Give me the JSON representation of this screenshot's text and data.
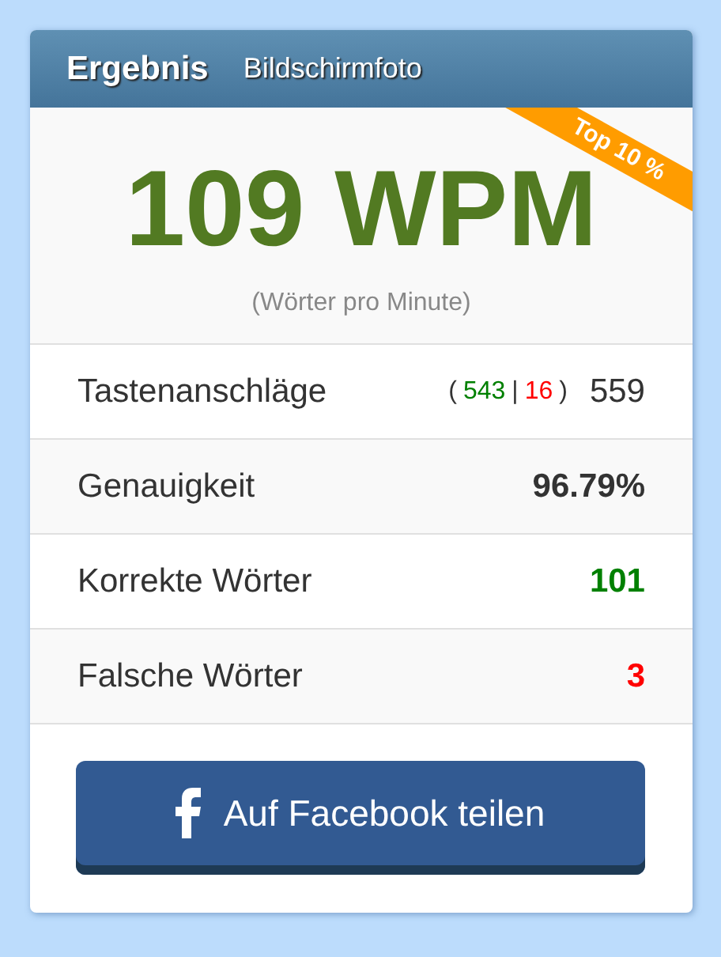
{
  "tabs": [
    {
      "label": "Ergebnis",
      "selected": true
    },
    {
      "label": "Bildschirmfoto",
      "selected": false
    }
  ],
  "score": {
    "value": "109 WPM",
    "caption": "(Wörter pro Minute)",
    "ribbon": "Top 10 %"
  },
  "stats": [
    {
      "kind": "keystrokes",
      "label": "Tastenanschläge",
      "open": "(",
      "correct": "543",
      "separator": "|",
      "wrong": "16",
      "close": ")",
      "total": "559"
    },
    {
      "kind": "value",
      "label": "Genauigkeit",
      "value": "96.79%",
      "color": "#333333"
    },
    {
      "kind": "value",
      "label": "Korrekte Wörter",
      "value": "101",
      "color": "#008000"
    },
    {
      "kind": "value",
      "label": "Falsche Wörter",
      "value": "3",
      "color": "#ff0000"
    }
  ],
  "share_button": {
    "label": "Auf Facebook teilen"
  }
}
